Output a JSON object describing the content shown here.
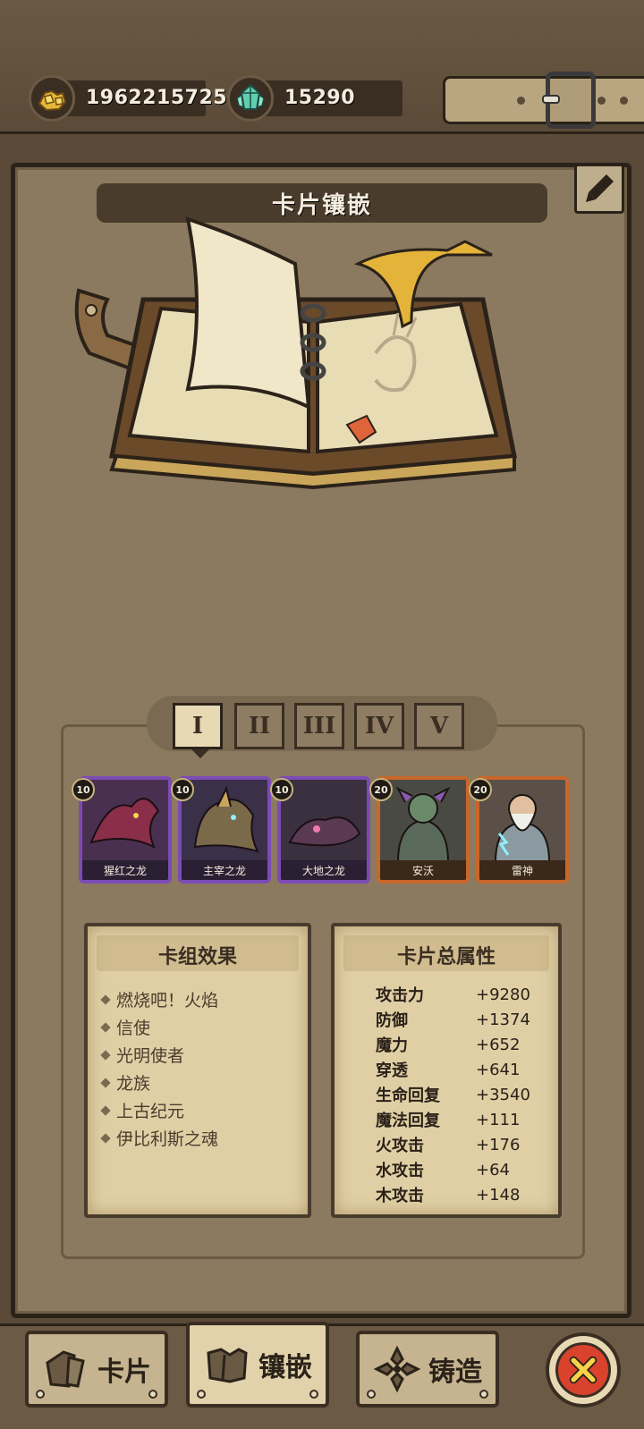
{
  "resources": {
    "gold": {
      "value": "1962215725",
      "icon": "gold-ore-icon"
    },
    "gems": {
      "value": "15290",
      "icon": "crystal-icon"
    }
  },
  "panel": {
    "title": "卡片镶嵌",
    "edit_icon": "pencil-icon"
  },
  "tabs": [
    {
      "label": "I",
      "active": true
    },
    {
      "label": "II",
      "active": false
    },
    {
      "label": "III",
      "active": false
    },
    {
      "label": "IV",
      "active": false
    },
    {
      "label": "V",
      "active": false
    }
  ],
  "cards": [
    {
      "level": "10",
      "name": "猩红之龙",
      "rarity": "epic",
      "frame_color": "#7c4bb5"
    },
    {
      "level": "10",
      "name": "主宰之龙",
      "rarity": "epic",
      "frame_color": "#7c4bb5"
    },
    {
      "level": "10",
      "name": "大地之龙",
      "rarity": "epic",
      "frame_color": "#7c4bb5"
    },
    {
      "level": "20",
      "name": "安沃",
      "rarity": "legendary",
      "frame_color": "#c9662a"
    },
    {
      "level": "20",
      "name": "雷神",
      "rarity": "legendary",
      "frame_color": "#c9662a"
    }
  ],
  "deck_effects": {
    "title": "卡组效果",
    "items": [
      "燃烧吧！火焰",
      "信使",
      "光明使者",
      "龙族",
      "上古纪元",
      "伊比利斯之魂"
    ]
  },
  "card_attributes": {
    "title": "卡片总属性",
    "items": [
      {
        "name": "攻击力",
        "value": "+9280"
      },
      {
        "name": "防御",
        "value": "+1374"
      },
      {
        "name": "魔力",
        "value": "+652"
      },
      {
        "name": "穿透",
        "value": "+641"
      },
      {
        "name": "生命回复",
        "value": "+3540"
      },
      {
        "name": "魔法回复",
        "value": "+111"
      },
      {
        "name": "火攻击",
        "value": "+176"
      },
      {
        "name": "水攻击",
        "value": "+64"
      },
      {
        "name": "木攻击",
        "value": "+148"
      }
    ]
  },
  "bottom_nav": [
    {
      "label": "卡片",
      "icon": "card-icon",
      "active": false
    },
    {
      "label": "镶嵌",
      "icon": "inlay-icon",
      "active": true
    },
    {
      "label": "铸造",
      "icon": "forge-icon",
      "active": false
    }
  ],
  "close_icon": "close-x-icon",
  "colors": {
    "epic_frame": "#7c4bb5",
    "legendary_frame": "#c9662a",
    "close_red": "#d9432d",
    "parchment": "#e0cfa5"
  }
}
